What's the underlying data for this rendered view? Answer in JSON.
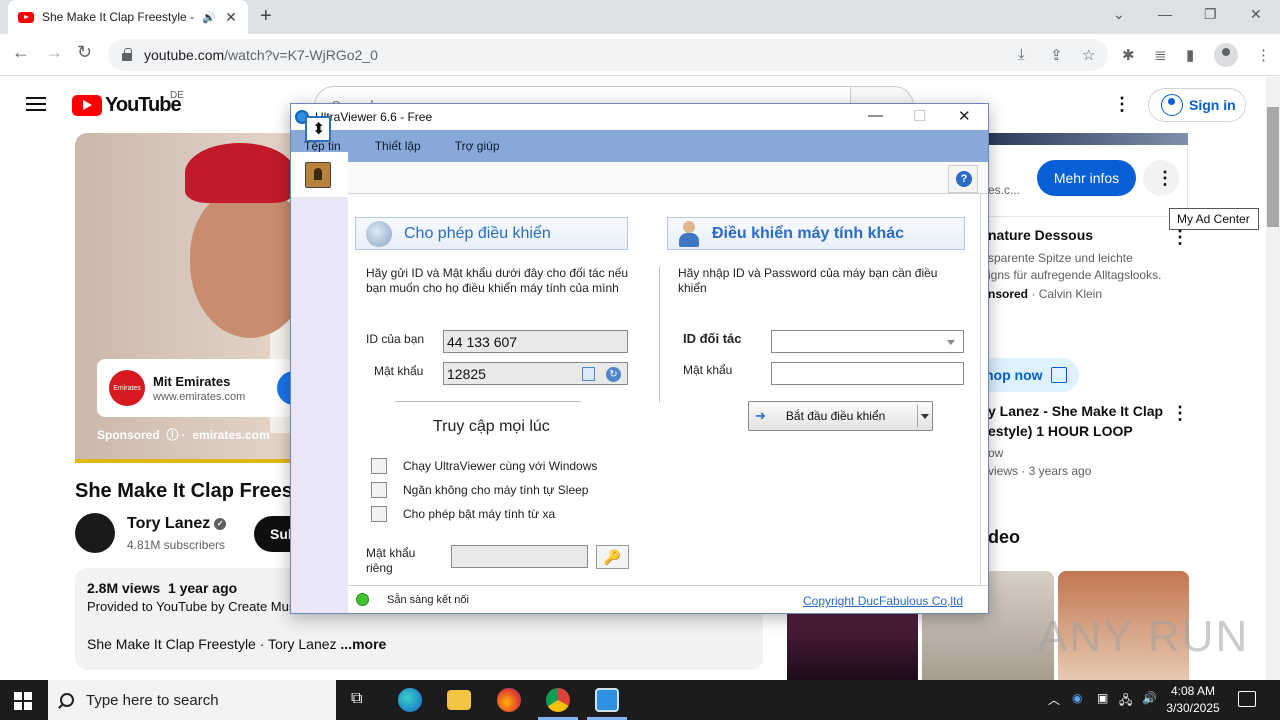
{
  "browser": {
    "tab_title": "She Make It Clap Freestyle -",
    "url_host": "youtube.com",
    "url_path": "/watch?v=K7-WjRGo2_0"
  },
  "youtube": {
    "logo_text": "YouTube",
    "region": "DE",
    "search_placeholder": "Search",
    "sign_in": "Sign in",
    "ad": {
      "title": "Mit Emirates",
      "url": "www.emirates.com",
      "logo_text": "Emirates",
      "sponsored": "Sponsored",
      "domain": "emirates.com"
    },
    "video_title": "She Make It Clap Freestyle",
    "channel_name": "Tory Lanez",
    "subscribers": "4.81M subscribers",
    "subscribe": "Subscribe",
    "description": {
      "views": "2.8M views",
      "age": "1 year ago",
      "provided": "Provided to YouTube by Create Music Group",
      "line": "She Make It Clap Freestyle · Tory Lanez",
      "more": "...more"
    },
    "right": {
      "site": "es.c...",
      "more_info": "Mehr infos",
      "tooltip": "My Ad Center",
      "ad_title": "nature Dessous",
      "ad_line1": "sparente Spitze und leichte",
      "ad_line2": "igns für aufregende Alltagslooks.",
      "ad_sponsor_label": "nsored",
      "ad_sponsor_name": "Calvin Klein",
      "shop_now": "hop now",
      "video_title_1": "y Lanez - She Make It Clap",
      "video_title_2": "estyle) 1 HOUR LOOP",
      "video_channel": "ow",
      "video_meta": "views · 3 years ago",
      "section_heading": "deo"
    },
    "watermark": "ANY RUN"
  },
  "ultraviewer": {
    "title": "UltraViewer 6.6 - Free",
    "menu": [
      "Tệp tin",
      "Thiết lập",
      "Trợ giúp"
    ],
    "allow_control": {
      "heading": "Cho phép điều khiển",
      "instruction": "Hãy gửi ID và Mật khẩu dưới đây cho đối tác nếu bạn muốn cho họ điều khiển máy tính của mình",
      "id_label": "ID của bạn",
      "id_value": "44 133 607",
      "password_label": "Mật khẩu",
      "password_value": "12825"
    },
    "remote_control": {
      "heading": "Điều khiển máy tính khác",
      "instruction": "Hãy nhập ID và Password của máy bạn cần điều khiển",
      "partner_id_label": "ID đối tác",
      "password_label": "Mật khẩu",
      "start_button": "Bắt đầu điều khiển"
    },
    "always_access": {
      "heading": "Truy cập mọi lúc",
      "options": [
        "Chạy UltraViewer cùng với Windows",
        "Ngăn không cho máy tính tự Sleep",
        "Cho phép bật máy tính từ xa"
      ],
      "private_password_label_1": "Mật khẩu",
      "private_password_label_2": "riêng"
    },
    "status": "Sẵn sàng kết nối",
    "copyright": "Copyright DucFabulous Co,ltd"
  },
  "taskbar": {
    "search_placeholder": "Type here to search",
    "time": "4:08 AM",
    "date": "3/30/2025"
  }
}
